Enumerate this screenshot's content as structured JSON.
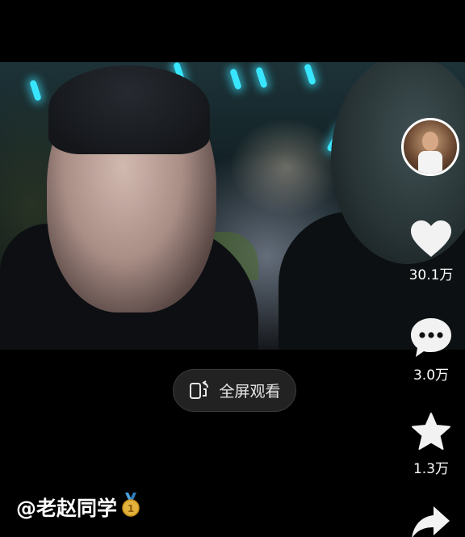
{
  "player": {
    "fullscreen_label": "全屏观看"
  },
  "actions": {
    "like_count": "30.1万",
    "comment_count": "3.0万",
    "favorite_count": "1.3万"
  },
  "author": {
    "username": "@老赵同学"
  },
  "icons": {
    "fullscreen": "rotate-phone-icon",
    "like": "heart-icon",
    "comment": "comment-icon",
    "favorite": "star-icon",
    "share": "share-icon",
    "badge": "medal-icon"
  },
  "colors": {
    "background": "#000000",
    "badge_gold": "#e3b23c",
    "badge_ribbon": "#4aa3df"
  }
}
